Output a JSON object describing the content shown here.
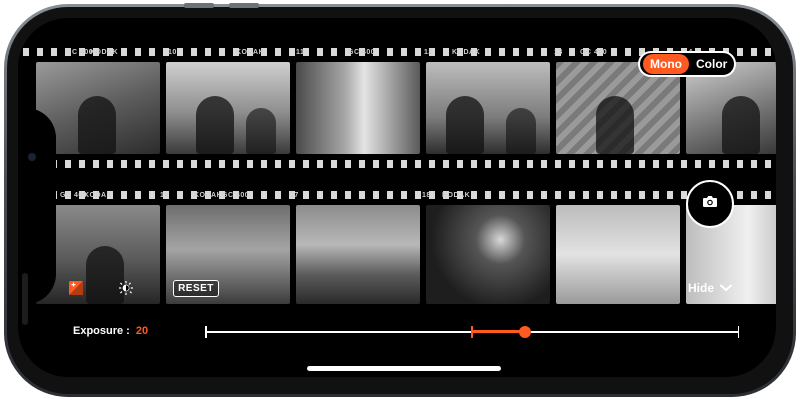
{
  "mode_toggle": {
    "mono_label": "Mono",
    "color_label": "Color",
    "active": "Mono"
  },
  "film": {
    "brand": "KODAK",
    "stock": "GC 400",
    "top_frame_numbers": [
      "10",
      "11",
      "12",
      "13",
      "14"
    ],
    "bottom_frame_numbers": [
      "16",
      "17",
      "18"
    ]
  },
  "toolbar": {
    "reset_label": "RESET",
    "hide_label": "Hide"
  },
  "exposure": {
    "label": "Exposure :",
    "value": "20",
    "position_fraction": 0.6
  },
  "colors": {
    "accent": "#ff5a1f",
    "background": "#000000",
    "text": "#ffffff"
  },
  "icons": {
    "camera": "camera-icon",
    "brightness": "brightness-icon",
    "exposure_tool": "exposure-tool-icon",
    "chevron": "chevron-down-icon"
  }
}
